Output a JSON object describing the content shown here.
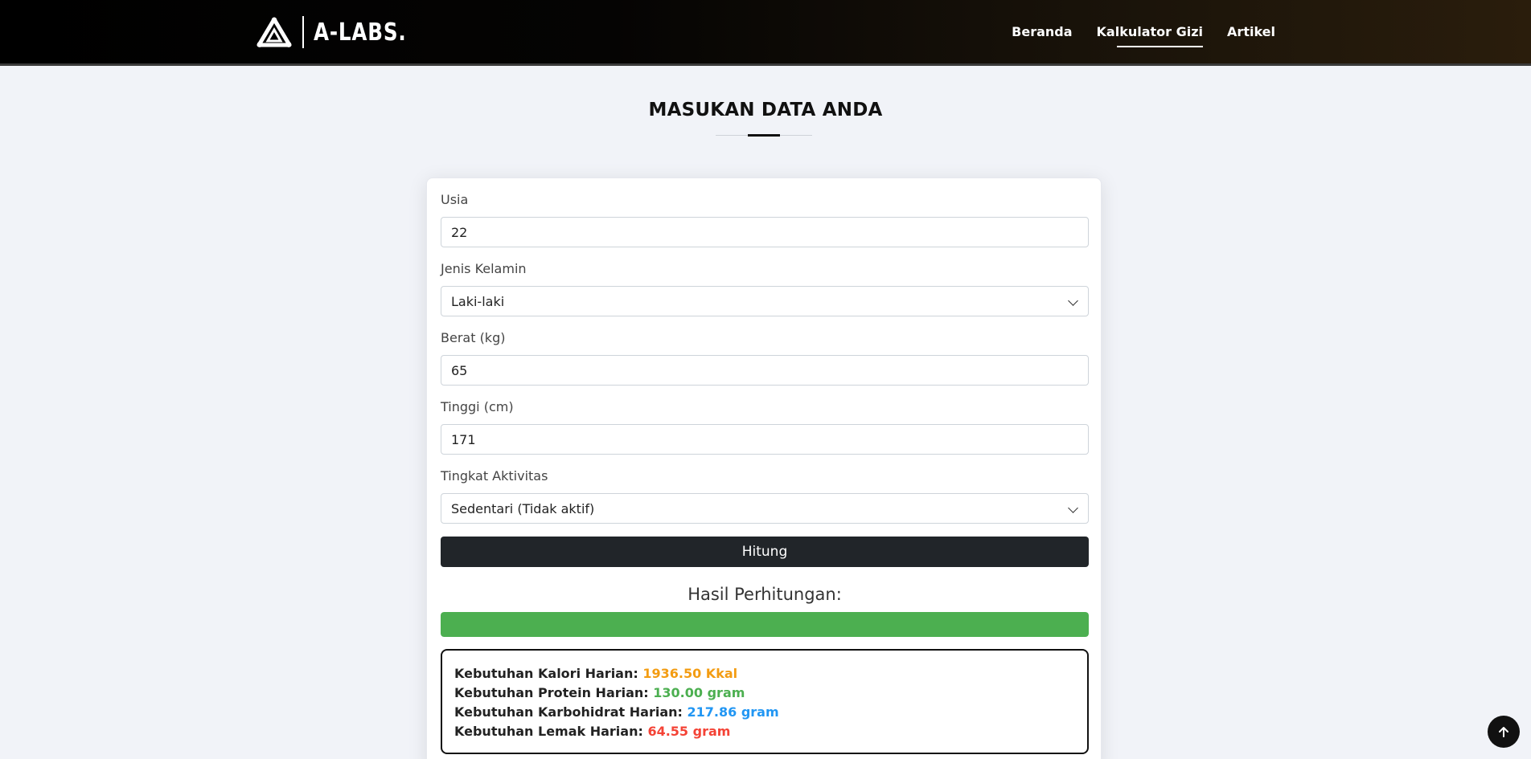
{
  "header": {
    "brand_name": "A-LABS.",
    "nav": [
      {
        "label": "Beranda",
        "active": false
      },
      {
        "label": "Kalkulator Gizi",
        "active": true
      },
      {
        "label": "Artikel",
        "active": false
      }
    ]
  },
  "page": {
    "title": "MASUKAN DATA ANDA"
  },
  "form": {
    "age": {
      "label": "Usia",
      "value": "22"
    },
    "gender": {
      "label": "Jenis Kelamin",
      "value": "Laki-laki"
    },
    "weight": {
      "label": "Berat (kg)",
      "value": "65"
    },
    "height": {
      "label": "Tinggi (cm)",
      "value": "171"
    },
    "activity": {
      "label": "Tingkat Aktivitas",
      "value": "Sedentari (Tidak aktif)"
    },
    "submit_label": "Hitung"
  },
  "result": {
    "title": "Hasil Perhitungan:",
    "progress_percent": 100,
    "progress_color": "#4caf50",
    "lines": [
      {
        "label": "Kebutuhan Kalori Harian:",
        "value": "1936.50 Kkal",
        "color": "#f39c12"
      },
      {
        "label": "Kebutuhan Protein Harian:",
        "value": "130.00 gram",
        "color": "#4caf50"
      },
      {
        "label": "Kebutuhan Karbohidrat Harian:",
        "value": "217.86 gram",
        "color": "#2196f3"
      },
      {
        "label": "Kebutuhan Lemak Harian:",
        "value": "64.55 gram",
        "color": "#f44336"
      }
    ]
  },
  "icons": {
    "logo": "triangle-logo-icon",
    "back_to_top": "arrow-up-icon",
    "select": "chevron-down-icon"
  }
}
